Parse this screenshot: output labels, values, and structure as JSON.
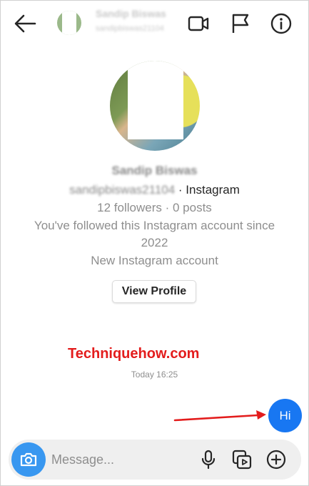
{
  "header": {
    "username": "Sandip Biswas",
    "handle": "sandipbiswas21104"
  },
  "profile": {
    "name": "Sandip Biswas",
    "handle": "sandipbiswas21104",
    "platform": " · Instagram",
    "followers_line": "12 followers · 0 posts",
    "followed_line_1": "You've followed this Instagram account since",
    "followed_line_2": "2022",
    "account_note": "New Instagram account",
    "view_profile_label": "View Profile"
  },
  "watermark": "Techniquehow.com",
  "chat": {
    "timestamp": "Today 16:25",
    "messages": [
      {
        "text": "Hi",
        "from": "me"
      }
    ]
  },
  "composer": {
    "placeholder": "Message..."
  },
  "colors": {
    "accent": "#1877f2",
    "camera": "#3897f0",
    "annotation": "#e31c1c"
  },
  "icons": [
    "back-arrow-icon",
    "video-call-icon",
    "flag-icon",
    "info-icon",
    "camera-icon",
    "microphone-icon",
    "gallery-icon",
    "add-icon"
  ]
}
